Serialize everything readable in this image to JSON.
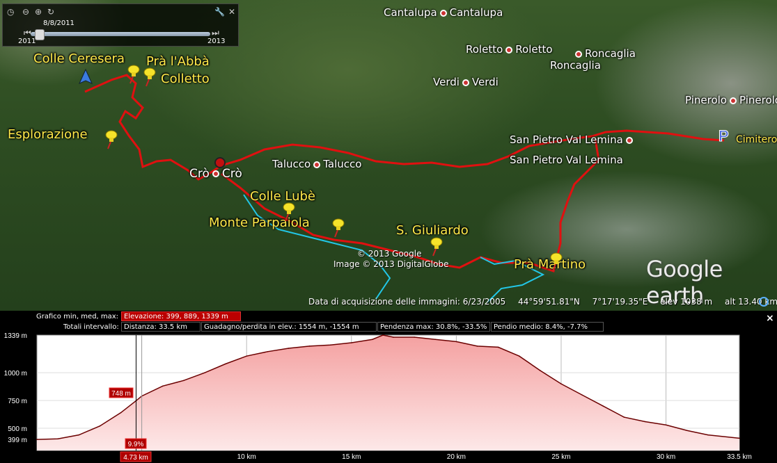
{
  "timeslider": {
    "date": "8/8/2011",
    "start_year": "2011",
    "end_year": "2013"
  },
  "places": [
    {
      "name": "Cantalupa",
      "label": "Cantalupa"
    },
    {
      "name": "Roletto",
      "label": "Roletto"
    },
    {
      "name": "Roncaglia",
      "label": "Roncaglia"
    },
    {
      "name": "Verdi",
      "label": "Verdi"
    },
    {
      "name": "Pinerolo",
      "label": "Pinerolo"
    },
    {
      "name": "San Pietro Val Lemina",
      "label": "San Pietro Val Lemina"
    },
    {
      "name": "Talucco",
      "label": "Talucco"
    },
    {
      "name": "Crò",
      "label": "Crò"
    },
    {
      "name": "Cimitero",
      "label": "Cimitero"
    }
  ],
  "waypoints": [
    {
      "label": "Colle Ceresera"
    },
    {
      "label": "Prà l'Abbà"
    },
    {
      "label": "Colletto"
    },
    {
      "label": "Esplorazione"
    },
    {
      "label": "Colle Lubè"
    },
    {
      "label": "Monte Parpaiola"
    },
    {
      "label": "S. Giuliardo"
    },
    {
      "label": "Prà Martino"
    }
  ],
  "copyright": [
    "© 2013 Google",
    "Image © 2013 DigitalGlobe"
  ],
  "logo": "Google earth",
  "status": {
    "imagery_date": "Data di acquisizione delle immagini: 6/23/2005",
    "lat": "44°59'51.81\"N",
    "lon": "7°17'19.35\"E",
    "elev": "elev  1038 m",
    "alt": "alt  13.40 km"
  },
  "profile": {
    "graph_label": "Grafico  min, med, max:",
    "elevation_box": "Elevazione: 399, 889, 1339 m",
    "totals_label": "Totali intervallo:",
    "distance_box": "Distanza: 33.5 km",
    "gain_box": "Guadagno/perdita in elev.: 1554 m, -1554 m",
    "slope_max_box": "Pendenza max: 30.8%, -33.5%",
    "slope_avg_box": "Pendio medio: 8.4%, -7.7%",
    "cursor_elev": "748 m",
    "cursor_slope": "9.9%",
    "cursor_dist": "4.73 km",
    "close": "×"
  },
  "colors": {
    "track": "#e01010",
    "waypoint_text": "#ffe94a",
    "chart_line": "#6b0000",
    "chart_fill": "#f6b8b8"
  },
  "chart_data": {
    "type": "area",
    "xlabel": "",
    "ylabel": "",
    "x_ticks": [
      "10 km",
      "15 km",
      "20 km",
      "25 km",
      "30 km",
      "33.5 km"
    ],
    "y_ticks": [
      "1339 m",
      "1000 m",
      "750 m",
      "500 m",
      "399 m"
    ],
    "xlim": [
      0,
      33.5
    ],
    "ylim": [
      399,
      1339
    ],
    "x": [
      0,
      1,
      2,
      3,
      4,
      4.73,
      5,
      6,
      7,
      8,
      9,
      10,
      11,
      12,
      13,
      14,
      15,
      16,
      16.5,
      17,
      18,
      19,
      20,
      21,
      22,
      23,
      24,
      25,
      26,
      27,
      28,
      29,
      30,
      31,
      32,
      33.5
    ],
    "y": [
      399,
      405,
      440,
      520,
      640,
      748,
      790,
      880,
      930,
      1000,
      1080,
      1150,
      1190,
      1220,
      1240,
      1250,
      1270,
      1300,
      1339,
      1320,
      1320,
      1300,
      1280,
      1240,
      1230,
      1150,
      1020,
      900,
      800,
      700,
      600,
      560,
      530,
      480,
      440,
      410
    ]
  }
}
